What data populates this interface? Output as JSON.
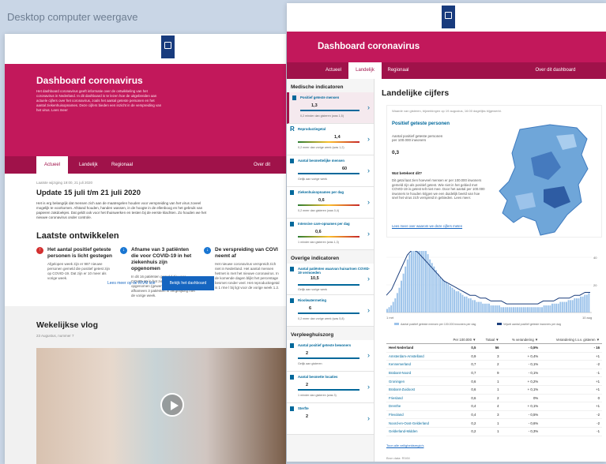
{
  "caption": "Desktop computer weergave",
  "left": {
    "title": "Dashboard coronavirus",
    "intro": "Het dashboard coronavirus geeft informatie over de ontwikkeling van het coronavirus in Nederland. In dit dashboard is te lezen hoe de uitgebreiden aan actuele cijfers over het coronavirus, zoals het aantal geteste personen en het aantal ziekenhuisopnames. Deze cijfers bieden een inzicht in de verspreiding van het virus. Lees meer",
    "tabs": [
      "Actueel",
      "Landelijk",
      "Regionaal",
      "Over dit dashbo"
    ],
    "updated": "Laatste wijziging 19:00, 21 juli 2020",
    "update_title": "Update 15 juli t/m 21 juli 2020",
    "update_text": "Het is erg belangrijk dat mensen zich aan de maatregelen houden voor verspreiding van het virus zoveel mogelijk te voorkomen. Afstand houden, handen wassen, in de hoogte in de ellenboog en het gebruik van papieren zakdoekjes. Dat geldt ook voor het thuiswerken en testen bij de eerste klachten. Zo houden we het nieuwe coronavirus onder controle.",
    "section": "Laatste ontwikkelen",
    "items": [
      {
        "title": "Het aantal positief geteste personen is licht gestegen",
        "text": "Afgelopen week zijn er 987 nieuwe personen gemeld die positief getest zijn op COVID-19. Dat zijn er 10 meer als vorige week.",
        "icon": "↑"
      },
      {
        "title": "Afname van 3 patiënten die voor COVID-19 in het ziekenhuis zijn opgenomen",
        "text": "In dit 16 patiënten gemeld die voor COVID-19 in het ziekenhuis zijn opgenomen (gewenst). Dat kan afhameen 3 patiënten in vergelijking met de vorige week.",
        "icon": "↓"
      },
      {
        "title": "De verspreiding van COVI neemt af",
        "text": "Het nieuwe coronavirus verspreidt zich niet in Nederland. Het aantal mensen hetmet is met het nieuwe coronavirus. In de komende dagen blijkt het percentage besmet ronder veel. Het reproductiegetal is 1 rme l bij ligt voor de vorige week 1.2.",
        "icon": "↓"
      }
    ],
    "rivm_link": "Lees meer op de RIVM site",
    "dashboard_button": "Bekijk het dashboard",
    "vlog_title": "Wekelijkse vlog",
    "vlog_sub": "23 Augustus, nummer 7"
  },
  "right": {
    "title": "Dashboard coronavirus",
    "tabs": [
      "Actueel",
      "Landelijk",
      "Regionaal",
      "Over dit dashboard"
    ],
    "sidebar": {
      "med_title": "Medische indicatoren",
      "med": [
        {
          "label": "Positief geteste mensen",
          "value": "1,3",
          "note": "0,2 minder dan gisteren (was 1,5)"
        },
        {
          "label": "Reproductiegetal",
          "value": "1,4",
          "note": "0,2 meer dan vorige week (was 1,2)"
        },
        {
          "label": "Aantal besmettelijke mensen",
          "value": "60",
          "note": "Gelijk aan vorige week"
        },
        {
          "label": "Ziekenhuisopnames per dag",
          "value": "0,6",
          "note": "0,2 meer dan gisteren (was 0,4)"
        },
        {
          "label": "Intensive care-opnames per dag",
          "value": "0,6",
          "note": "1 minder dan gisteren (was 1,3)"
        }
      ],
      "other_title": "Overige indicatoren",
      "other": [
        {
          "label": "Aantal patiënten waarvan huisartsen COVID-19 vermoeden",
          "value": "10,5",
          "note": "Gelijk aan vorige week"
        },
        {
          "label": "Rioolwatermeting",
          "value": "6",
          "note": "0,2 meer dan vorige week (was 5,8)"
        }
      ],
      "care_title": "Verpleeghuiszorg",
      "care": [
        {
          "label": "Aantal positief geteste bewoners",
          "value": "2",
          "note": "Gelijk aan gisteren"
        },
        {
          "label": "Aantal besmette locaties",
          "value": "2",
          "note": "1 minder dan gisteren (was 3)"
        },
        {
          "label": "Sterfte",
          "value": "2",
          "note": ""
        }
      ]
    },
    "main": {
      "title": "Landelijke cijfers",
      "notice": "Waarde van gisteren, bijwerkingen op 19 augustus, 16:00 dagelijks bijgewerkt.",
      "panel_title": "Positief geteste personen",
      "panel_sub": "Aantal positief geteste personen per 100.000 inwoners",
      "panel_value": "0,3",
      "panel_q": "Wat betekent dit?",
      "panel_desc": "Dit getal laat zien hoeveel mensen er per 100.000 inwoners gemeld zijn als positief getest. Wie niet in het gebied met COVID-19 is getest telt niet mee. Door het aantal per 100.000 inwoners te houden krijgen we een duidelijk beeld van hoe snel het virus zich verspreid in gebieden. Lees meer.",
      "panel_link": "Lees meer over waarom we deze cijfers meten",
      "chart_legend": [
        "Aantal positief geteste mensen per 100.000 inwoners per dag",
        "Vrijwel aantal positief geteste inwoners per dag"
      ],
      "chart_axis": [
        "1 mrt",
        "10 aug"
      ],
      "y_right": [
        "40",
        "20"
      ],
      "y_left": [
        "50",
        "25"
      ],
      "table_head": [
        "Per 100.000 ▼",
        "Totaal ▼",
        "% verandering ▼",
        "Verandering t.o.v. gisteren ▼"
      ],
      "table_rows": [
        [
          "Heel Nederland",
          "0,5",
          "56",
          "- 0,5%",
          "- 16"
        ],
        [
          "Amsterdam-Amstelland",
          "0,9",
          "3",
          "+ 0,4%",
          "+1"
        ],
        [
          "Kennemerland",
          "0,7",
          "2",
          "- 0,1%",
          "-2"
        ],
        [
          "Brabant-Noord",
          "0,7",
          "9",
          "- 0,1%",
          "-1"
        ],
        [
          "Groningen",
          "0,6",
          "1",
          "+ 0,2%",
          "+1"
        ],
        [
          "Brabant-Zuidoost",
          "0,6",
          "1",
          "+ 0,1%",
          "+1"
        ],
        [
          "Friesland",
          "0,6",
          "2",
          "0%",
          "0"
        ],
        [
          "Drenthe",
          "0,4",
          "4",
          "+ 0,1%",
          "+1"
        ],
        [
          "Flevoland",
          "0,4",
          "3",
          "- 0,5%",
          "-2"
        ],
        [
          "Noord-en-Oost-Gelderland",
          "0,2",
          "1",
          "- 0,6%",
          "-2"
        ],
        [
          "Gelderland-Midden",
          "0,2",
          "1",
          "- 0,3%",
          "-1"
        ]
      ],
      "table_link": "Toon alle veiligheidsregio's",
      "table_foot": "Bron data: RIVM"
    }
  },
  "chart_data": {
    "type": "bar",
    "title": "",
    "x": [
      "1 mrt",
      "10 aug"
    ],
    "values": [
      2,
      3,
      4,
      6,
      8,
      11,
      14,
      18,
      22,
      26,
      30,
      33,
      36,
      38,
      40,
      41,
      40,
      39,
      37,
      35,
      33,
      30,
      28,
      26,
      24,
      22,
      20,
      19,
      18,
      17,
      16,
      15,
      14,
      13,
      12,
      12,
      11,
      10,
      9,
      9,
      8,
      8,
      7,
      7,
      6,
      6,
      6,
      5,
      5,
      5,
      5,
      4,
      4,
      4,
      4,
      4,
      3,
      3,
      3,
      3,
      3,
      3,
      3,
      3,
      3,
      3,
      3,
      3,
      3,
      3,
      3,
      3,
      3,
      3,
      3,
      3,
      3,
      4,
      4,
      4,
      4,
      5,
      5,
      5,
      5,
      6,
      6,
      6,
      6,
      7,
      7,
      7,
      8,
      8,
      8,
      9,
      9,
      10,
      10,
      11
    ],
    "line": [
      6,
      8,
      12,
      16,
      20,
      22,
      21,
      19,
      17,
      15,
      13,
      11,
      10,
      9,
      8,
      7,
      6,
      6,
      5,
      5,
      4,
      4,
      4,
      3,
      3,
      3,
      3,
      3,
      3,
      3,
      4,
      4,
      4,
      5,
      5,
      5,
      6,
      6,
      7,
      7
    ],
    "ylim": [
      0,
      50
    ]
  }
}
